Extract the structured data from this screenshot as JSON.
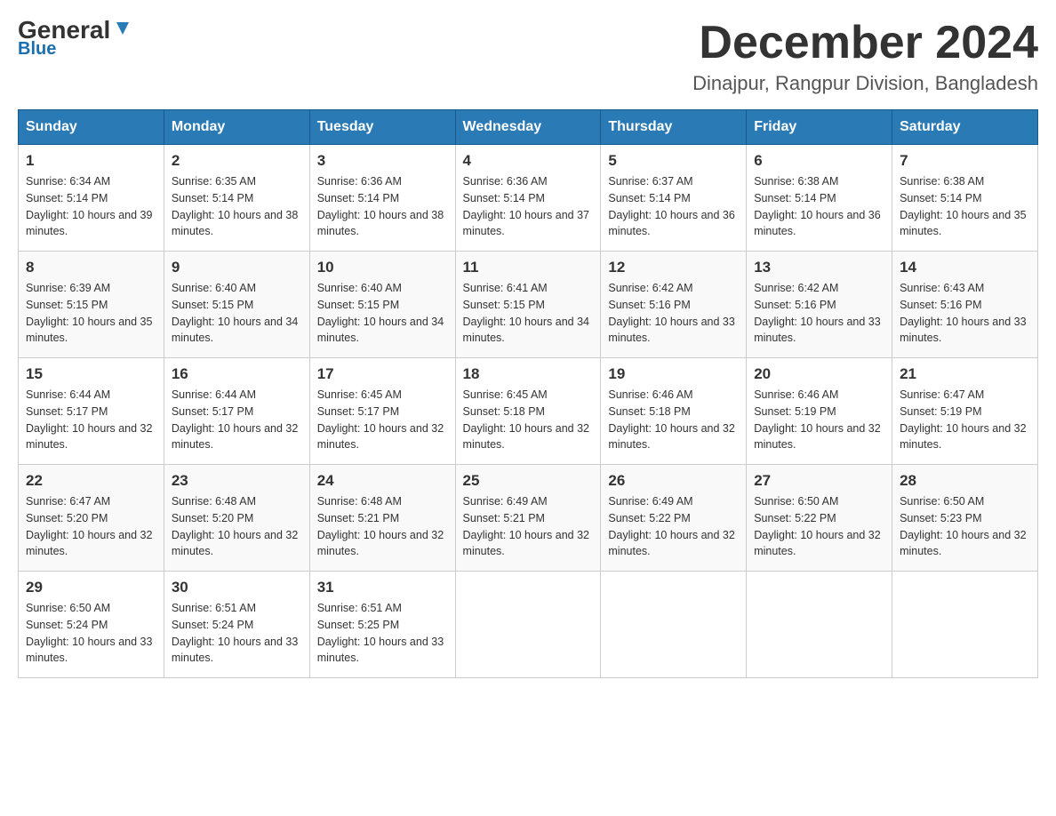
{
  "header": {
    "logo_general": "General",
    "logo_blue": "Blue",
    "title": "December 2024",
    "subtitle": "Dinajpur, Rangpur Division, Bangladesh"
  },
  "weekdays": [
    "Sunday",
    "Monday",
    "Tuesday",
    "Wednesday",
    "Thursday",
    "Friday",
    "Saturday"
  ],
  "weeks": [
    [
      {
        "day": "1",
        "sunrise": "6:34 AM",
        "sunset": "5:14 PM",
        "daylight": "10 hours and 39 minutes."
      },
      {
        "day": "2",
        "sunrise": "6:35 AM",
        "sunset": "5:14 PM",
        "daylight": "10 hours and 38 minutes."
      },
      {
        "day": "3",
        "sunrise": "6:36 AM",
        "sunset": "5:14 PM",
        "daylight": "10 hours and 38 minutes."
      },
      {
        "day": "4",
        "sunrise": "6:36 AM",
        "sunset": "5:14 PM",
        "daylight": "10 hours and 37 minutes."
      },
      {
        "day": "5",
        "sunrise": "6:37 AM",
        "sunset": "5:14 PM",
        "daylight": "10 hours and 36 minutes."
      },
      {
        "day": "6",
        "sunrise": "6:38 AM",
        "sunset": "5:14 PM",
        "daylight": "10 hours and 36 minutes."
      },
      {
        "day": "7",
        "sunrise": "6:38 AM",
        "sunset": "5:14 PM",
        "daylight": "10 hours and 35 minutes."
      }
    ],
    [
      {
        "day": "8",
        "sunrise": "6:39 AM",
        "sunset": "5:15 PM",
        "daylight": "10 hours and 35 minutes."
      },
      {
        "day": "9",
        "sunrise": "6:40 AM",
        "sunset": "5:15 PM",
        "daylight": "10 hours and 34 minutes."
      },
      {
        "day": "10",
        "sunrise": "6:40 AM",
        "sunset": "5:15 PM",
        "daylight": "10 hours and 34 minutes."
      },
      {
        "day": "11",
        "sunrise": "6:41 AM",
        "sunset": "5:15 PM",
        "daylight": "10 hours and 34 minutes."
      },
      {
        "day": "12",
        "sunrise": "6:42 AM",
        "sunset": "5:16 PM",
        "daylight": "10 hours and 33 minutes."
      },
      {
        "day": "13",
        "sunrise": "6:42 AM",
        "sunset": "5:16 PM",
        "daylight": "10 hours and 33 minutes."
      },
      {
        "day": "14",
        "sunrise": "6:43 AM",
        "sunset": "5:16 PM",
        "daylight": "10 hours and 33 minutes."
      }
    ],
    [
      {
        "day": "15",
        "sunrise": "6:44 AM",
        "sunset": "5:17 PM",
        "daylight": "10 hours and 32 minutes."
      },
      {
        "day": "16",
        "sunrise": "6:44 AM",
        "sunset": "5:17 PM",
        "daylight": "10 hours and 32 minutes."
      },
      {
        "day": "17",
        "sunrise": "6:45 AM",
        "sunset": "5:17 PM",
        "daylight": "10 hours and 32 minutes."
      },
      {
        "day": "18",
        "sunrise": "6:45 AM",
        "sunset": "5:18 PM",
        "daylight": "10 hours and 32 minutes."
      },
      {
        "day": "19",
        "sunrise": "6:46 AM",
        "sunset": "5:18 PM",
        "daylight": "10 hours and 32 minutes."
      },
      {
        "day": "20",
        "sunrise": "6:46 AM",
        "sunset": "5:19 PM",
        "daylight": "10 hours and 32 minutes."
      },
      {
        "day": "21",
        "sunrise": "6:47 AM",
        "sunset": "5:19 PM",
        "daylight": "10 hours and 32 minutes."
      }
    ],
    [
      {
        "day": "22",
        "sunrise": "6:47 AM",
        "sunset": "5:20 PM",
        "daylight": "10 hours and 32 minutes."
      },
      {
        "day": "23",
        "sunrise": "6:48 AM",
        "sunset": "5:20 PM",
        "daylight": "10 hours and 32 minutes."
      },
      {
        "day": "24",
        "sunrise": "6:48 AM",
        "sunset": "5:21 PM",
        "daylight": "10 hours and 32 minutes."
      },
      {
        "day": "25",
        "sunrise": "6:49 AM",
        "sunset": "5:21 PM",
        "daylight": "10 hours and 32 minutes."
      },
      {
        "day": "26",
        "sunrise": "6:49 AM",
        "sunset": "5:22 PM",
        "daylight": "10 hours and 32 minutes."
      },
      {
        "day": "27",
        "sunrise": "6:50 AM",
        "sunset": "5:22 PM",
        "daylight": "10 hours and 32 minutes."
      },
      {
        "day": "28",
        "sunrise": "6:50 AM",
        "sunset": "5:23 PM",
        "daylight": "10 hours and 32 minutes."
      }
    ],
    [
      {
        "day": "29",
        "sunrise": "6:50 AM",
        "sunset": "5:24 PM",
        "daylight": "10 hours and 33 minutes."
      },
      {
        "day": "30",
        "sunrise": "6:51 AM",
        "sunset": "5:24 PM",
        "daylight": "10 hours and 33 minutes."
      },
      {
        "day": "31",
        "sunrise": "6:51 AM",
        "sunset": "5:25 PM",
        "daylight": "10 hours and 33 minutes."
      },
      null,
      null,
      null,
      null
    ]
  ]
}
